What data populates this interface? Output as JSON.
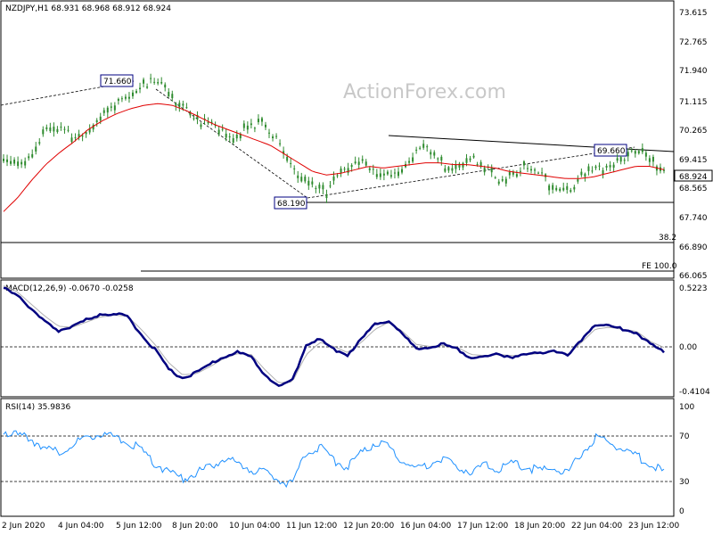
{
  "chart_data": [
    {
      "type": "candlestick",
      "title": "NZDJPY,H1  68.931 68.968 68.912 68.924",
      "watermark": "ActionForex.com",
      "y_ticks": [
        "73.615",
        "72.765",
        "71.940",
        "71.115",
        "70.265",
        "69.415",
        "68.565",
        "67.740",
        "66.890",
        "66.065"
      ],
      "ylim": [
        66.065,
        73.615
      ],
      "current_price": "68.924",
      "annotations": [
        {
          "label": "71.660",
          "value": 71.66
        },
        {
          "label": "68.190",
          "value": 68.19
        },
        {
          "label": "69.660",
          "value": 69.66
        },
        {
          "label": "38.2",
          "value": 67.05
        },
        {
          "label": "FE 100.0",
          "value": 66.45
        }
      ],
      "series": [
        {
          "name": "price",
          "values": [
            69.2,
            69.35,
            69.6,
            70.1,
            70.25,
            70.15,
            70.3,
            70.5,
            70.9,
            71.4,
            71.6,
            71.55,
            71.25,
            71.0,
            70.5,
            70.25,
            70.1,
            70.3,
            70.45,
            70.1,
            69.6,
            69.0,
            68.55,
            68.3,
            69.2,
            69.35,
            69.05,
            68.8,
            69.15,
            69.45,
            69.65,
            69.35,
            69.25,
            69.35,
            69.2,
            68.9,
            69.05,
            69.05,
            68.95,
            68.8,
            68.55,
            68.75,
            69.1,
            69.35,
            69.5,
            69.55,
            69.4,
            69.1
          ]
        },
        {
          "name": "MA",
          "values": [
            67.9,
            68.3,
            68.8,
            69.25,
            69.6,
            69.9,
            70.25,
            70.5,
            70.7,
            70.85,
            70.95,
            71.0,
            70.95,
            70.8,
            70.6,
            70.4,
            70.25,
            70.1,
            69.95,
            69.8,
            69.55,
            69.3,
            69.05,
            68.95,
            69.0,
            69.1,
            69.2,
            69.15,
            69.2,
            69.25,
            69.3,
            69.3,
            69.25,
            69.25,
            69.2,
            69.15,
            69.05,
            69.0,
            68.95,
            68.9,
            68.85,
            68.85,
            68.9,
            69.0,
            69.1,
            69.2,
            69.2,
            69.1
          ]
        }
      ]
    },
    {
      "type": "line",
      "title": "MACD(12,26,9) -0.0670 -0.0258",
      "y_ticks": [
        "0.5223",
        "0.00",
        "-0.4104"
      ],
      "ylim": [
        -0.5,
        0.62
      ],
      "zero_line": 0,
      "series": [
        {
          "name": "MACD",
          "values": [
            0.55,
            0.5,
            0.35,
            0.22,
            0.14,
            0.18,
            0.24,
            0.3,
            0.3,
            0.28,
            0.1,
            -0.05,
            -0.25,
            -0.33,
            -0.28,
            -0.2,
            -0.12,
            -0.08,
            -0.12,
            -0.3,
            -0.42,
            -0.35,
            0.0,
            0.05,
            -0.05,
            -0.1,
            0.05,
            0.2,
            0.24,
            0.1,
            -0.05,
            -0.02,
            0.0,
            -0.05,
            -0.13,
            -0.12,
            -0.1,
            -0.12,
            -0.1,
            -0.09,
            -0.05,
            -0.12,
            0.05,
            0.2,
            0.18,
            0.15,
            0.12,
            0.0,
            -0.07
          ]
        },
        {
          "name": "Signal",
          "values": [
            0.58,
            0.52,
            0.4,
            0.28,
            0.18,
            0.17,
            0.22,
            0.27,
            0.29,
            0.28,
            0.15,
            0.0,
            -0.18,
            -0.3,
            -0.29,
            -0.22,
            -0.14,
            -0.09,
            -0.1,
            -0.25,
            -0.38,
            -0.37,
            -0.1,
            0.02,
            -0.02,
            -0.08,
            0.02,
            0.15,
            0.22,
            0.13,
            0.0,
            -0.02,
            -0.01,
            -0.03,
            -0.1,
            -0.11,
            -0.1,
            -0.11,
            -0.1,
            -0.09,
            -0.06,
            -0.1,
            0.02,
            0.15,
            0.17,
            0.15,
            0.13,
            0.03,
            -0.03
          ]
        }
      ]
    },
    {
      "type": "line",
      "title": "RSI(14) 35.9836",
      "y_ticks": [
        "100",
        "70",
        "30",
        "0"
      ],
      "ylim": [
        0,
        100
      ],
      "levels": [
        70,
        30
      ],
      "series": [
        {
          "name": "RSI",
          "values": [
            76,
            72,
            68,
            60,
            55,
            62,
            70,
            74,
            70,
            66,
            58,
            45,
            38,
            30,
            36,
            42,
            50,
            45,
            40,
            36,
            30,
            25,
            55,
            60,
            48,
            42,
            55,
            65,
            60,
            48,
            40,
            45,
            50,
            42,
            38,
            44,
            40,
            45,
            42,
            38,
            40,
            35,
            55,
            70,
            65,
            60,
            52,
            45,
            36
          ]
        }
      ]
    }
  ],
  "x_ticks": [
    "2 Jun 2020",
    "4 Jun 04:00",
    "5 Jun 12:00",
    "8 Jun 20:00",
    "10 Jun 04:00",
    "11 Jun 12:00",
    "12 Jun 20:00",
    "16 Jun 04:00",
    "17 Jun 12:00",
    "18 Jun 20:00",
    "22 Jun 04:00",
    "23 Jun 12:00"
  ],
  "colors": {
    "candle": "#2e8b2e",
    "ma": "#e00000",
    "macd": "#000080",
    "signal": "#b0b0b0",
    "rsi": "#1e90ff",
    "wm": "#c8c8c8",
    "label_border": "#000080"
  }
}
